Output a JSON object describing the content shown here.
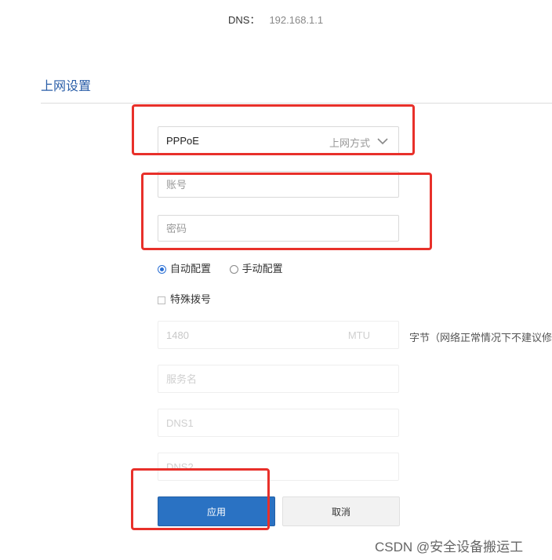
{
  "dns": {
    "label": "DNS：",
    "value": "192.168.1.1"
  },
  "section": {
    "title": "上网设置"
  },
  "connection": {
    "value": "PPPoE",
    "label": "上网方式",
    "icon": "chevron-down-icon"
  },
  "account": {
    "placeholder": "账号",
    "value": ""
  },
  "password": {
    "placeholder": "密码",
    "value": ""
  },
  "config_mode": {
    "options": [
      {
        "label": "自动配置",
        "checked": true
      },
      {
        "label": "手动配置",
        "checked": false
      }
    ]
  },
  "special_dial": {
    "label": "特殊拨号",
    "checked": false
  },
  "mtu": {
    "value": "1480",
    "unit": "MTU",
    "note": "字节（网络正常情况下不建议修"
  },
  "service_name": {
    "placeholder": "服务名"
  },
  "dns1": {
    "placeholder": "DNS1"
  },
  "dns2": {
    "placeholder": "DNS2"
  },
  "buttons": {
    "apply": "应用",
    "cancel": "取消"
  },
  "annotation": {
    "color": "#e8302a"
  },
  "watermark": "CSDN @安全设备搬运工"
}
